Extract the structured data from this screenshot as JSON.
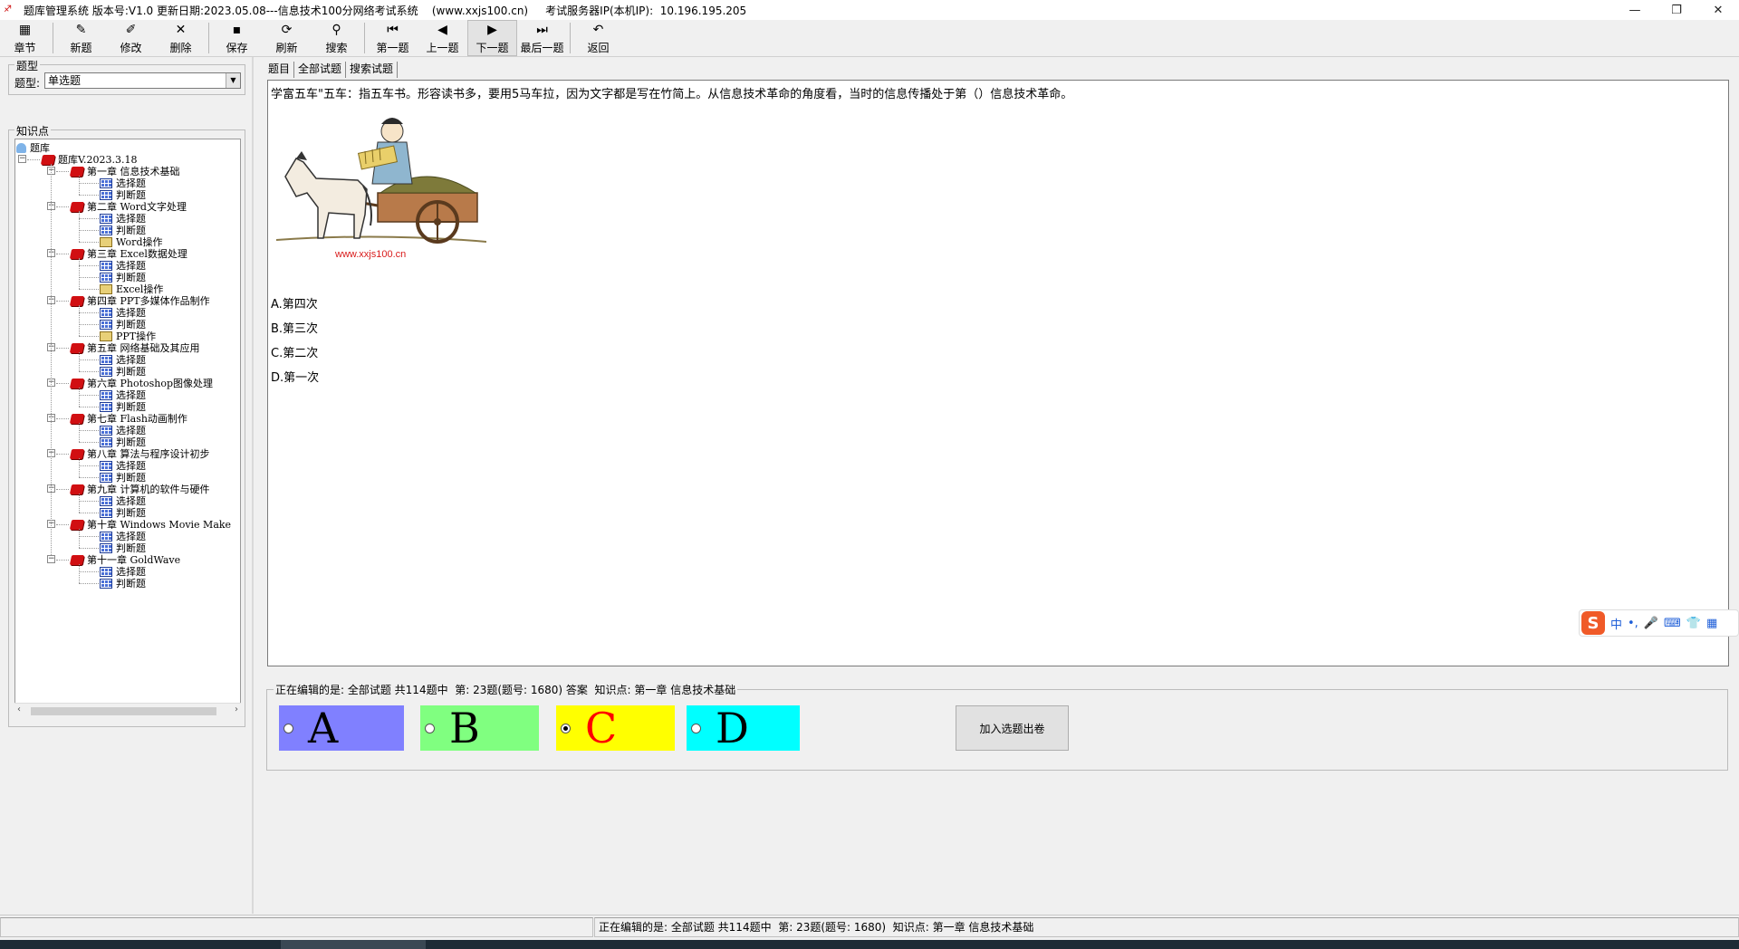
{
  "window": {
    "title": "题库管理系统 版本号:V1.0 更新日期:2023.05.08---信息技术100分网络考试系统    (www.xxjs100.cn)     考试服务器IP(本机IP):  10.196.195.205",
    "icon": "app-logo-icon",
    "min": "—",
    "restore": "❐",
    "close": "✕"
  },
  "toolbar": [
    {
      "label": "章节",
      "icon": "chapter-icon",
      "glyph": "▦"
    },
    {
      "label": "新题",
      "icon": "new-icon",
      "glyph": "✎"
    },
    {
      "label": "修改",
      "icon": "edit-icon",
      "glyph": "✐"
    },
    {
      "label": "删除",
      "icon": "delete-icon",
      "glyph": "✕"
    },
    {
      "label": "保存",
      "icon": "save-icon",
      "glyph": "▪"
    },
    {
      "label": "刷新",
      "icon": "refresh-icon",
      "glyph": "⟳"
    },
    {
      "label": "搜索",
      "icon": "search-icon",
      "glyph": "⚲"
    },
    {
      "label": "第一题",
      "icon": "first-icon",
      "glyph": "⏮"
    },
    {
      "label": "上一题",
      "icon": "prev-icon",
      "glyph": "◀"
    },
    {
      "label": "下一题",
      "icon": "next-icon",
      "glyph": "▶"
    },
    {
      "label": "最后一题",
      "icon": "last-icon",
      "glyph": "⏭"
    },
    {
      "label": "返回",
      "icon": "back-icon",
      "glyph": "↶"
    }
  ],
  "left": {
    "type_group": "题型",
    "type_label": "题型:",
    "type_value": "单选题",
    "knowledge_group": "知识点",
    "tree_root": "题库",
    "tree_db": "题库V.2023.3.18",
    "chapters": [
      {
        "name": "第一章 信息技术基础",
        "items": [
          "选择题",
          "判断题"
        ]
      },
      {
        "name": "第二章 Word文字处理",
        "items": [
          "选择题",
          "判断题",
          "Word操作"
        ]
      },
      {
        "name": "第三章 Excel数据处理",
        "items": [
          "选择题",
          "判断题",
          "Excel操作"
        ]
      },
      {
        "name": "第四章 PPT多媒体作品制作",
        "items": [
          "选择题",
          "判断题",
          "PPT操作"
        ]
      },
      {
        "name": "第五章 网络基础及其应用",
        "items": [
          "选择题",
          "判断题"
        ]
      },
      {
        "name": "第六章 Photoshop图像处理",
        "items": [
          "选择题",
          "判断题"
        ]
      },
      {
        "name": "第七章 Flash动画制作",
        "items": [
          "选择题",
          "判断题"
        ]
      },
      {
        "name": "第八章 算法与程序设计初步",
        "items": [
          "选择题",
          "判断题"
        ]
      },
      {
        "name": "第九章 计算机的软件与硬件",
        "items": [
          "选择题",
          "判断题"
        ]
      },
      {
        "name": "第十章 Windows Movie Make",
        "items": [
          "选择题",
          "判断题"
        ]
      },
      {
        "name": "第十一章 GoldWave",
        "items": [
          "选择题",
          "判断题"
        ]
      }
    ]
  },
  "tabs": [
    "题目",
    "全部试题",
    "搜索试题"
  ],
  "question": {
    "text": "学富五车\"五车：指五车书。形容读书多，要用5马车拉，因为文字都是写在竹简上。从信息技术革命的角度看，当时的信息传播处于第（）信息技术革命。",
    "image_caption": "www.xxjs100.cn",
    "options": [
      "A.第四次",
      "B.第三次",
      "C.第二次",
      "D.第一次"
    ]
  },
  "ime": {
    "logo": "S",
    "items": [
      "中",
      "•,",
      "🎤",
      "⌨",
      "👕",
      "▦"
    ]
  },
  "answer": {
    "legend": "正在编辑的是: 全部试题 共114题中  第: 23题(题号: 1680) 答案  知识点: 第一章 信息技术基础",
    "choices": [
      {
        "letter": "A",
        "bg": "#8080ff",
        "color": "#000000",
        "selected": false
      },
      {
        "letter": "B",
        "bg": "#80ff80",
        "color": "#000000",
        "selected": false
      },
      {
        "letter": "C",
        "bg": "#ffff00",
        "color": "#ff0000",
        "selected": true
      },
      {
        "letter": "D",
        "bg": "#00ffff",
        "color": "#000000",
        "selected": false
      }
    ],
    "add_button": "加入选题出卷"
  },
  "status": {
    "text": "正在编辑的是: 全部试题 共114题中  第: 23题(题号: 1680)  知识点: 第一章 信息技术基础"
  }
}
